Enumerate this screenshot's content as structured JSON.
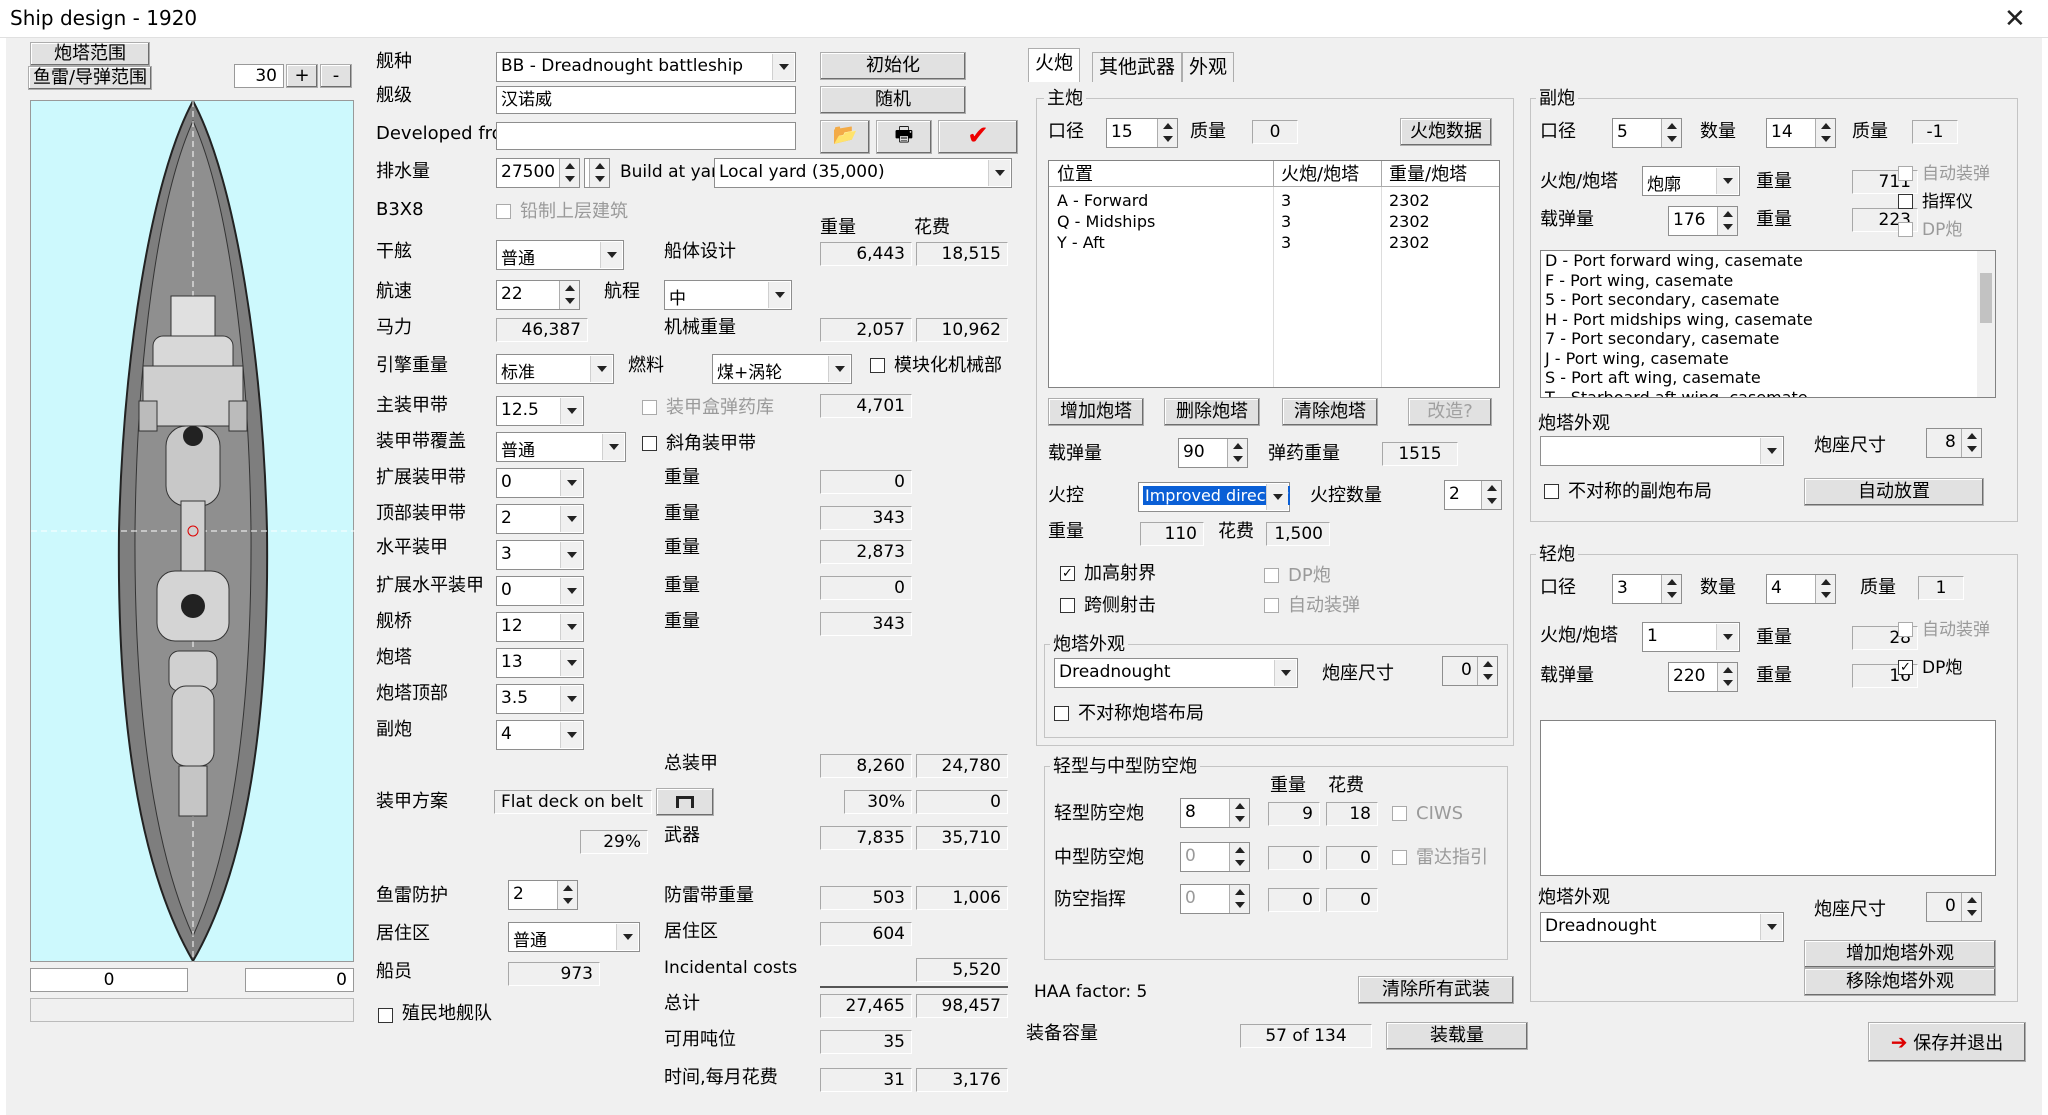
{
  "window": {
    "title": "Ship design - 1920",
    "close": "✕"
  },
  "left": {
    "turret_range_btn": "炮塔范围",
    "torpedo_range_btn": "鱼雷/导弹范围",
    "zoom": "30",
    "zoom_plus": "+",
    "zoom_minus": "-",
    "coord_left": "0",
    "coord_right": "0"
  },
  "general": {
    "hull_type_label": "舰种",
    "hull_type": "BB - Dreadnought battleship",
    "class_label": "舰级",
    "class_name": "汉诺威",
    "developed_label": "Developed from",
    "developed": "",
    "init_btn": "初始化",
    "random_btn": "随机",
    "disp_label": "排水量",
    "disp": "27500",
    "build_label": "Build at yard",
    "build_yard": "Local yard (35,000)",
    "b3x8": "B3X8",
    "restrict_super": "铅制上层建筑",
    "weight_hdr": "重量",
    "cost_hdr": "花费",
    "freeboard_label": "干舷",
    "freeboard": "普通",
    "hull_design_label": "船体设计",
    "hull_weight": "6,443",
    "hull_cost": "18,515",
    "speed_label": "航速",
    "speed": "22",
    "range_label": "航程",
    "range": "中",
    "hp_label": "马力",
    "hp": "46,387",
    "mach_label": "机械重量",
    "mach_weight": "2,057",
    "mach_cost": "10,962",
    "engine_label": "引擎重量",
    "engine": "标准",
    "fuel_label": "燃料",
    "fuel": "煤+涡轮",
    "modular": "模块化机械部",
    "main_armor_label": "主装甲带",
    "main_armor": "12.5",
    "box_mag": "装甲盒弹药库",
    "belt_weight": "4,701",
    "belt_cover_label": "装甲带覆盖",
    "belt_cover": "普通",
    "inclined": "斜角装甲带",
    "ext_belt_label": "扩展装甲带",
    "ext_belt": "0",
    "w_lbl": "重量",
    "w_ext_belt": "0",
    "upper_belt_label": "顶部装甲带",
    "upper_belt": "2",
    "w_upper_belt": "343",
    "deck_label": "水平装甲",
    "deck": "3",
    "w_deck": "2,873",
    "ext_deck_label": "扩展水平装甲",
    "ext_deck": "0",
    "w_ext_deck": "0",
    "ct_label": "舰桥",
    "ct": "12",
    "w_ct": "343",
    "turret_label": "炮塔",
    "turret": "13",
    "turret_top_label": "炮塔顶部",
    "turret_top": "3.5",
    "secondary_label": "副炮",
    "secondary": "4",
    "total_armor_label": "总装甲",
    "total_armor_w": "8,260",
    "total_armor_c": "24,780",
    "armor_scheme_label": "装甲方案",
    "armor_scheme": "Flat deck on belt",
    "armor_pct": "30%",
    "armor_pct_c": "0",
    "pct29": "29%",
    "weapons_label": "武器",
    "weapons_w": "7,835",
    "weapons_c": "35,710",
    "torp_def_label": "鱼雷防护",
    "torp_def": "2",
    "torp_belt_label": "防雷带重量",
    "torp_w": "503",
    "torp_c": "1,006",
    "accom_label": "居住区",
    "accom": "普通",
    "accom_lbl2": "居住区",
    "accom_w": "604",
    "crew_label": "船员",
    "crew": "973",
    "incidental_label": "Incidental costs",
    "incidental_c": "5,520",
    "colonial": "殖民地舰队",
    "total_label": "总计",
    "total_w": "27,465",
    "total_c": "98,457",
    "avail_label": "可用吨位",
    "avail": "35",
    "time_label": "时间,每月花费",
    "time": "31",
    "monthly": "3,176"
  },
  "tabs": [
    "火炮",
    "其他武器",
    "外观"
  ],
  "main_gun": {
    "group": "主炮",
    "cal_label": "口径",
    "cal": "15",
    "qual_label": "质量",
    "qual": "0",
    "data_btn": "火炮数据",
    "cols": [
      "位置",
      "火炮/炮塔",
      "重量/炮塔"
    ],
    "rows": [
      {
        "pos": "A - Forward",
        "guns": "3",
        "w": "2302"
      },
      {
        "pos": "Q - Midships",
        "guns": "3",
        "w": "2302"
      },
      {
        "pos": "Y - Aft",
        "guns": "3",
        "w": "2302"
      }
    ],
    "add_btn": "增加炮塔",
    "del_btn": "删除炮塔",
    "clear_btn": "清除炮塔",
    "refit_btn": "改造?",
    "ammo_label": "载弹量",
    "ammo": "90",
    "ammo_w_label": "弹药重量",
    "ammo_w": "1515",
    "fc_label": "火控",
    "fc": "Improved director",
    "fc_num_label": "火控数量",
    "fc_num": "2",
    "w_label": "重量",
    "w": "110",
    "c_label": "花费",
    "c": "1,500",
    "hi_angle": "加高射界",
    "dp": "DP炮",
    "superfire": "跨侧射击",
    "autoload": "自动装弹",
    "look_group": "炮塔外观",
    "look": "Dreadnought",
    "mount_size_label": "炮座尺寸",
    "mount_size": "0",
    "asym": "不对称炮塔布局"
  },
  "aa": {
    "group": "轻型与中型防空炮",
    "w_hdr": "重量",
    "c_hdr": "花费",
    "light_label": "轻型防空炮",
    "light": "8",
    "light_w": "9",
    "light_c": "18",
    "ciws": "CIWS",
    "med_label": "中型防空炮",
    "med": "0",
    "med_w": "0",
    "med_c": "0",
    "radar": "雷达指引",
    "dir_label": "防空指挥",
    "dir": "0",
    "dir_w": "0",
    "dir_c": "0"
  },
  "haa": "HAA factor: 5",
  "clear_all": "清除所有武装",
  "equip_label": "装备容量",
  "equip": "57 of 134",
  "load_btn": "装载量",
  "sec_gun": {
    "group": "副炮",
    "cal_label": "口径",
    "cal": "5",
    "num_label": "数量",
    "num": "14",
    "qual_label": "质量",
    "qual": "-1",
    "mount_label": "火炮/炮塔",
    "mount": "炮廓",
    "w_label": "重量",
    "w": "711",
    "autoload": "自动装弹",
    "ammo_label": "载弹量",
    "ammo": "176",
    "ammo_w": "223",
    "director": "指挥仪",
    "dp": "DP炮",
    "list": [
      "D - Port forward wing, casemate",
      "F - Port wing, casemate",
      "5 - Port secondary, casemate",
      "H - Port midships wing, casemate",
      "7 - Port secondary, casemate",
      "J - Port wing, casemate",
      "S - Port aft wing, casemate",
      "T - Starboard aft wing, casemate"
    ],
    "look_label": "炮塔外观",
    "look": "",
    "mount_size_label": "炮座尺寸",
    "mount_size": "8",
    "asym": "不对称的副炮布局",
    "auto_btn": "自动放置"
  },
  "light_gun": {
    "group": "轻炮",
    "cal_label": "口径",
    "cal": "3",
    "num_label": "数量",
    "num": "4",
    "qual_label": "质量",
    "qual": "1",
    "mount_label": "火炮/炮塔",
    "mount": "1",
    "w_label": "重量",
    "w": "28",
    "autoload": "自动装弹",
    "ammo_label": "载弹量",
    "ammo": "220",
    "ammo_w": "16",
    "dp": "DP炮",
    "look_label": "炮塔外观",
    "look": "Dreadnought",
    "mount_size_label": "炮座尺寸",
    "mount_size": "0",
    "add_look": "增加炮塔外观",
    "rm_look": "移除炮塔外观"
  },
  "save_btn": "保存并退出"
}
